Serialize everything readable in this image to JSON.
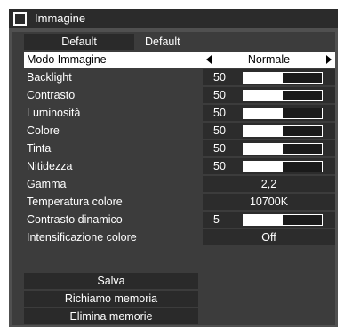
{
  "window": {
    "title": "Immagine"
  },
  "default": {
    "button_label": "Default",
    "value": "Default"
  },
  "settings": [
    {
      "label": "Modo Immagine",
      "value": "Normale"
    },
    {
      "label": "Backlight",
      "value": "50",
      "level": 0.5
    },
    {
      "label": "Contrasto",
      "value": "50",
      "level": 0.5
    },
    {
      "label": "Luminosità",
      "value": "50",
      "level": 0.5
    },
    {
      "label": "Colore",
      "value": "50",
      "level": 0.5
    },
    {
      "label": "Tinta",
      "value": "50",
      "level": 0.5
    },
    {
      "label": "Nitidezza",
      "value": "50",
      "level": 0.5
    },
    {
      "label": "Gamma",
      "value": "2,2"
    },
    {
      "label": "Temperatura colore",
      "value": "10700K"
    },
    {
      "label": "Contrasto dinamico",
      "value": "5",
      "level": 0.5
    },
    {
      "label": "Intensificazione colore",
      "value": "Off"
    }
  ],
  "actions": {
    "save_label": "Salva",
    "recall_label": "Richiamo memoria",
    "delete_label": "Elimina memorie"
  },
  "colors": {
    "selected_row": "#ffffff",
    "panel": "#3c3c3c",
    "frame": "#505050"
  }
}
